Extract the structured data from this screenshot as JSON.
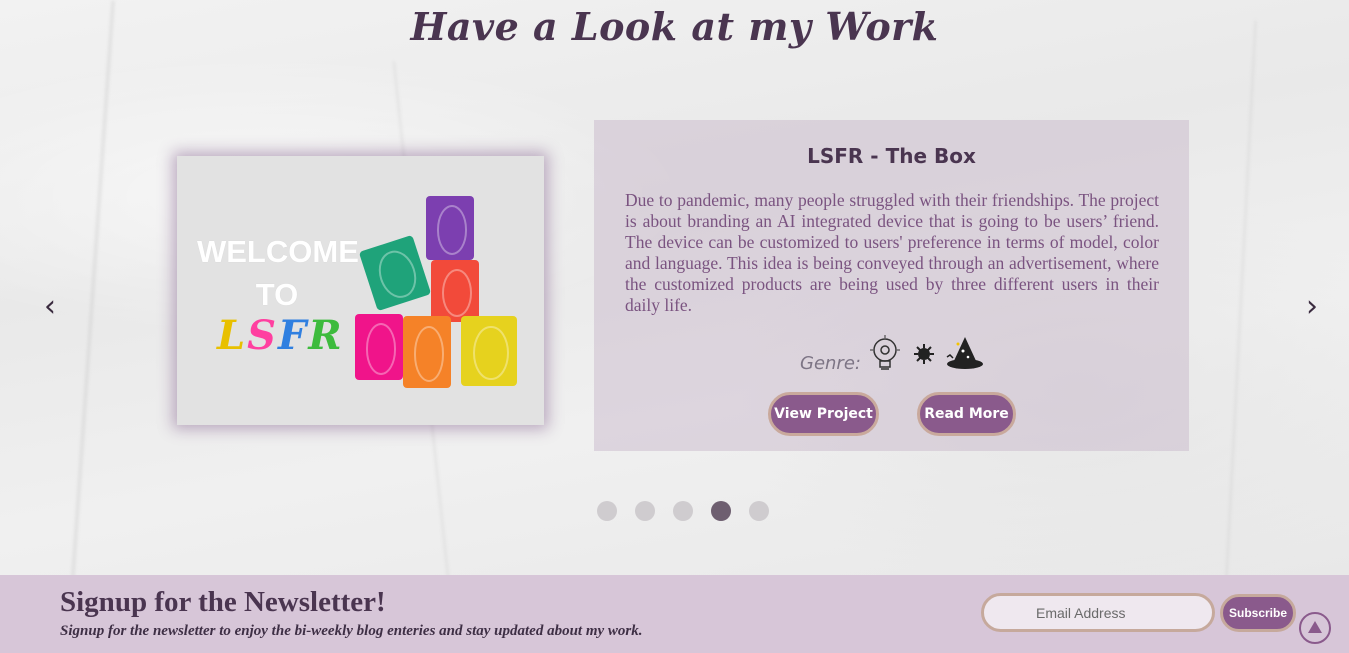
{
  "section": {
    "title": "Have a Look at my Work"
  },
  "slider": {
    "prev_label": "‹",
    "next_label": "›",
    "image": {
      "icon": "welcome-to-lsfr-blocks-image",
      "welcome_line1": "WELCOME",
      "welcome_line2": "TO",
      "logo_letters": [
        "L",
        "S",
        "F",
        "R"
      ]
    },
    "dots": {
      "count": 5,
      "active_index": 3
    }
  },
  "project": {
    "title": "LSFR - The Box",
    "description": "Due to pandemic, many people struggled with their friendships. The project is about branding an AI integrated device that is going to be users’ friend. The device can be customized to users' preference in terms of model, color and language. This idea is being conveyed through an advertisement, where the customized products are being used by three different users in their daily life.",
    "genre_label": "Genre:",
    "genre_icons": [
      "lightbulb-gear-icon",
      "virus-icon",
      "wizard-hat-icon"
    ],
    "view_button": "View Project",
    "read_button": "Read More"
  },
  "newsletter": {
    "title": "Signup for the Newsletter!",
    "subtitle": "Signup for the newsletter to enjoy the bi-weekly blog enteries and stay updated about my work.",
    "email_placeholder": "Email Address",
    "subscribe_label": "Subscribe"
  },
  "colors": {
    "accent": "#8a5a8c",
    "title": "#4a3550",
    "panel": "#c6b4c8",
    "footer": "#d7c6d8",
    "dot_active": "#6e5f70",
    "dot_inactive": "#cfcccf"
  }
}
